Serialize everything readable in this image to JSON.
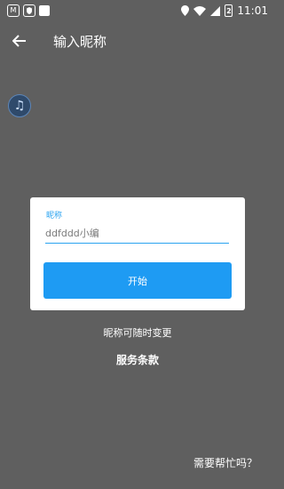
{
  "status_bar": {
    "time": "11:01",
    "left_icons": [
      "mv-app-icon",
      "vpn-shield-icon",
      "notification-square-icon"
    ],
    "battery_label": "2"
  },
  "app_bar": {
    "title": "输入昵称"
  },
  "form": {
    "label": "昵称",
    "input_value": "ddfddd小编",
    "start_label": "开始"
  },
  "hint": "昵称可随时变更",
  "terms_link": "服务条款",
  "help_link": "需要帮忙吗？",
  "colors": {
    "background": "#5f5f5f",
    "accent": "#1e9bf3",
    "card": "#ffffff"
  }
}
